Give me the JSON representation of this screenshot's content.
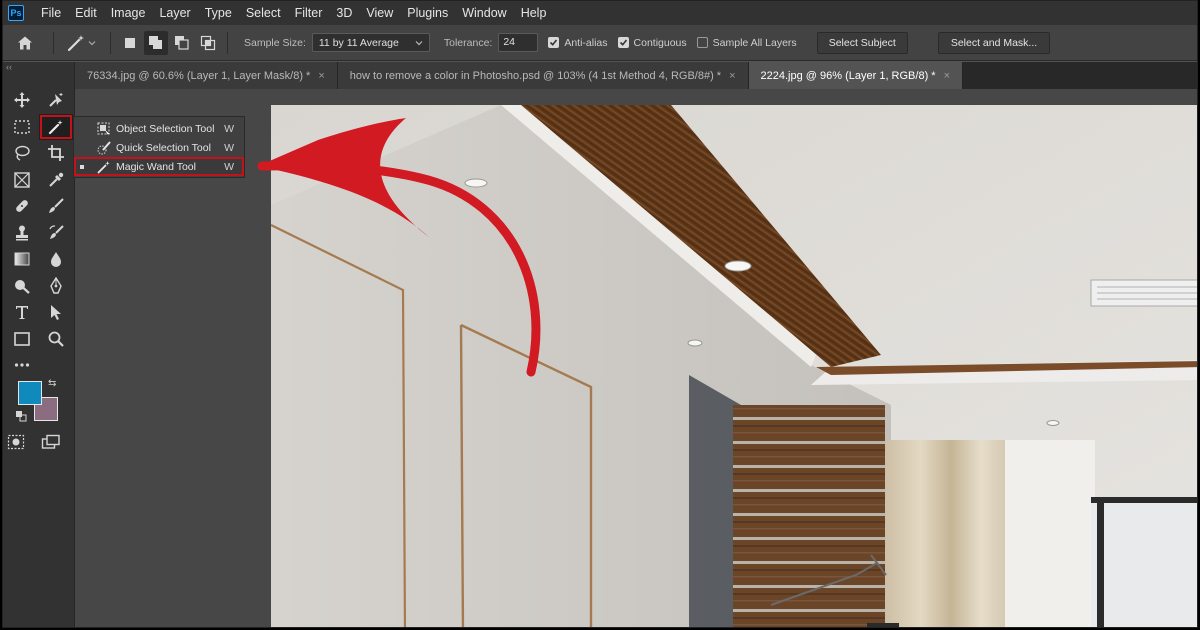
{
  "app": {
    "logo": "Ps"
  },
  "menu": [
    "File",
    "Edit",
    "Image",
    "Layer",
    "Type",
    "Select",
    "Filter",
    "3D",
    "View",
    "Plugins",
    "Window",
    "Help"
  ],
  "options": {
    "sample_size_label": "Sample Size:",
    "sample_size_value": "11 by 11 Average",
    "tolerance_label": "Tolerance:",
    "tolerance_value": "24",
    "anti_alias": {
      "label": "Anti-alias",
      "checked": true
    },
    "contiguous": {
      "label": "Contiguous",
      "checked": true
    },
    "sample_all_layers": {
      "label": "Sample All Layers",
      "checked": false
    },
    "select_subject": "Select Subject",
    "select_and_mask": "Select and Mask..."
  },
  "toolbox": {
    "collapse": "‹‹"
  },
  "tabs": [
    {
      "label": "76334.jpg @ 60.6% (Layer 1, Layer Mask/8) *",
      "close": "×",
      "active": false
    },
    {
      "label": "how to remove a color in Photosho.psd @ 103% (4 1st Method 4, RGB/8#) *",
      "close": "×",
      "active": false
    },
    {
      "label": "2224.jpg @ 96% (Layer 1, RGB/8) *",
      "close": "×",
      "active": true
    }
  ],
  "flyout": [
    {
      "label": "Object Selection Tool",
      "key": "W",
      "icon": "object-selection-icon"
    },
    {
      "label": "Quick Selection Tool",
      "key": "W",
      "icon": "quick-selection-icon"
    },
    {
      "label": "Magic Wand Tool",
      "key": "W",
      "icon": "magic-wand-icon",
      "selected": true
    }
  ],
  "colors": {
    "foreground": "#1089bd",
    "background": "#8a6d80",
    "highlight": "#c4121b"
  }
}
